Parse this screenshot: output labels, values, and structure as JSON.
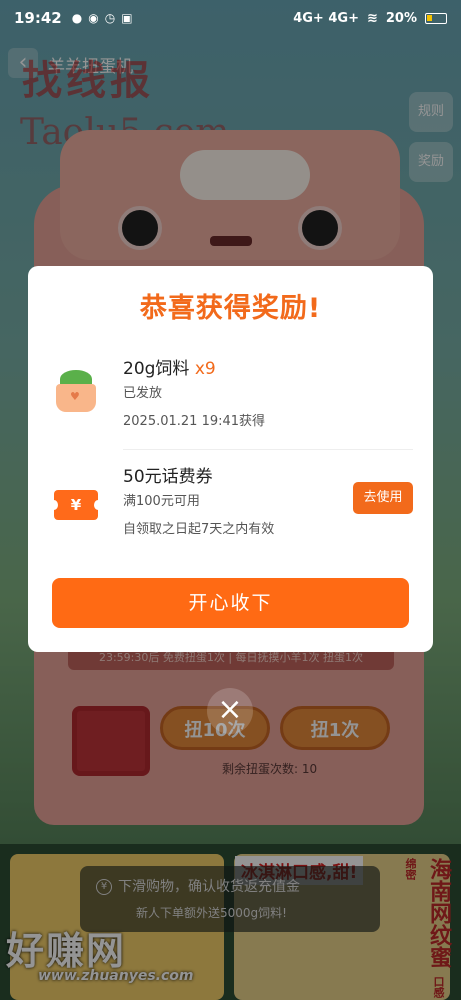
{
  "status_bar": {
    "time": "19:42",
    "battery": "20%",
    "network": "4G+ 4G+",
    "icons": [
      "wechat-icon",
      "weibo-icon",
      "clock-icon",
      "gallery-icon"
    ]
  },
  "top_bar": {
    "title": "羊羊扭蛋机",
    "rules_label": "规则",
    "reward_label": "奖励"
  },
  "machine": {
    "counter_text": "23:59:30后 免费扭蛋1次 | 每日抚摸小羊1次 扭蛋1次",
    "spin_ten_label": "扭10次",
    "spin_one_label": "扭1次",
    "remaining_text": "剩余扭蛋次数: 10"
  },
  "bottom": {
    "notice_line1": "下滑购物，确认收货返充值金",
    "notice_line2": "新人下单额外送5000g饲料!",
    "promo_tag": "冰淇淋口感,甜!",
    "vertical_tag": "海南网纹蜜",
    "vertical_small": "口感绵密"
  },
  "watermarks": {
    "top_text": "找线报",
    "top_url": "Taolu5.com",
    "bottom_text": "好赚网",
    "bottom_url": "www.zhuanyes.com"
  },
  "modal": {
    "title": "恭喜获得奖励!",
    "items": [
      {
        "name": "20g饲料",
        "qty": "x9",
        "status": "已发放",
        "note": "2025.01.21 19:41获得",
        "icon": "feed-pot-icon"
      },
      {
        "name": "50元话费券",
        "condition": "满100元可用",
        "note": "自领取之日起7天之内有效",
        "action_label": "去使用",
        "icon": "coupon-icon",
        "icon_text": "¥"
      }
    ],
    "confirm_label": "开心收下",
    "close_icon": "close-icon"
  },
  "colors": {
    "accent": "#f26a1b",
    "button": "#ff6a14",
    "overlay": "rgba(0,0,0,0.42)"
  }
}
